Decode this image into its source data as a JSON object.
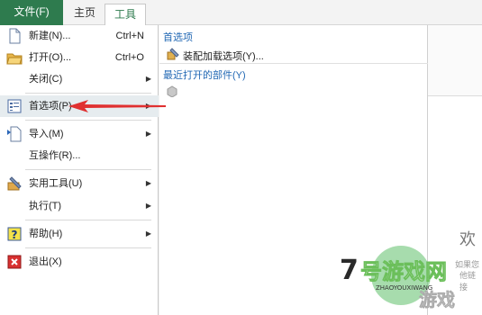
{
  "tabs": {
    "file": "文件(F)",
    "home": "主页",
    "tools": "工具"
  },
  "menu": {
    "items": [
      {
        "label": "新建(N)...",
        "shortcut": "Ctrl+N"
      },
      {
        "label": "打开(O)...",
        "shortcut": "Ctrl+O"
      },
      {
        "label": "关闭(C)"
      },
      {
        "label": "首选项(P)"
      },
      {
        "label": "导入(M)"
      },
      {
        "label": "互操作(R)..."
      },
      {
        "label": "实用工具(U)"
      },
      {
        "label": "执行(T)"
      },
      {
        "label": "帮助(H)"
      },
      {
        "label": "退出(X)"
      }
    ]
  },
  "submenu": {
    "heading_prefs": "首选项",
    "item_addins": "装配加载选项(Y)...",
    "heading_recent": "最近打开的部件(Y)"
  },
  "background": {
    "welcome": "欢",
    "info1": "如果您",
    "info2": "他链接"
  },
  "watermark": {
    "main": "7号游戏网",
    "sub": "ZHAOYOUXIWANG"
  },
  "colors": {
    "file_tab": "#2e7b4e",
    "accent": "#2268b4",
    "arrow": "#e03030"
  }
}
